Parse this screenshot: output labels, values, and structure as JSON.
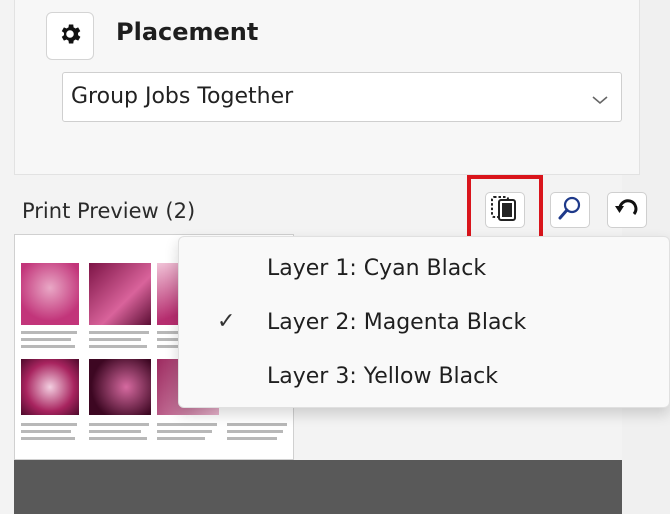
{
  "placement": {
    "title": "Placement",
    "dropdown_value": "Group Jobs Together"
  },
  "preview": {
    "label": "Print Preview (2)"
  },
  "toolbar": {
    "layers_icon": "layers-icon",
    "zoom_icon": "magnifier-icon",
    "reset_icon": "undo-icon",
    "highlight_color": "#d9141b"
  },
  "layer_menu": {
    "items": [
      {
        "label": "Layer 1: Cyan Black",
        "checked": false
      },
      {
        "label": "Layer 2: Magenta Black",
        "checked": true
      },
      {
        "label": "Layer 3: Yellow Black",
        "checked": false
      }
    ],
    "check_glyph": "✓"
  },
  "colors": {
    "magenta_preview": "#c2357a",
    "dark_canvas": "#595959"
  }
}
